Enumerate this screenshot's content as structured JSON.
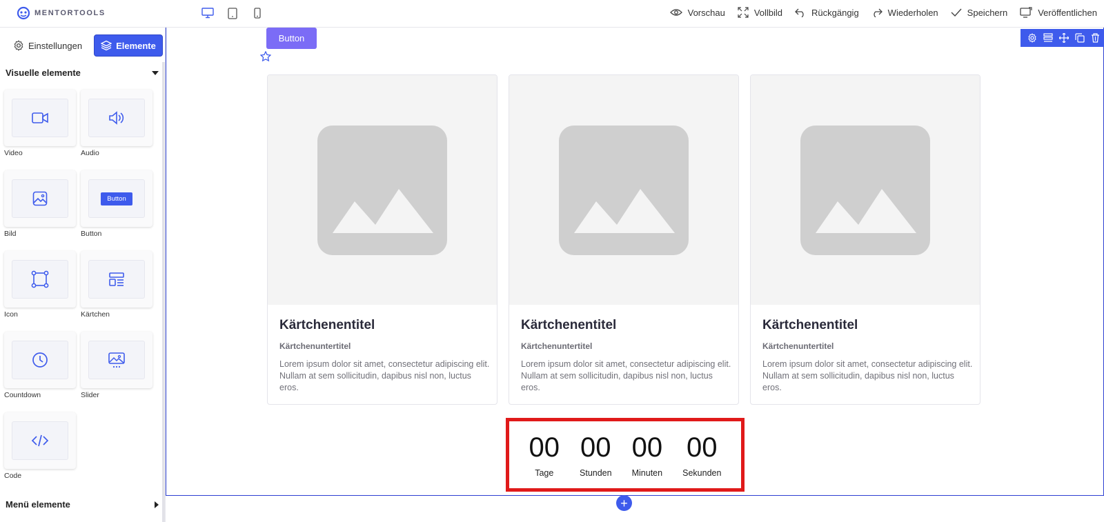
{
  "app": {
    "brand": "MENTORTOOLS"
  },
  "devices": [
    {
      "name": "desktop-icon"
    },
    {
      "name": "tablet-icon"
    },
    {
      "name": "mobile-icon"
    }
  ],
  "header": {
    "actions": [
      {
        "label": "Vorschau",
        "icon": "eye-icon"
      },
      {
        "label": "Vollbild",
        "icon": "fullscreen-icon"
      },
      {
        "label": "Rückgängig",
        "icon": "undo-icon"
      },
      {
        "label": "Wiederholen",
        "icon": "redo-icon"
      },
      {
        "label": "Speichern",
        "icon": "check-icon"
      },
      {
        "label": "Veröffentlichen",
        "icon": "monitor-publish-icon"
      }
    ]
  },
  "sidebar": {
    "tabs": [
      {
        "label": "Einstellungen",
        "icon": "gear-icon",
        "active": false
      },
      {
        "label": "Elemente",
        "icon": "layers-icon",
        "active": true
      }
    ],
    "visual_section_title": "Visuelle elemente",
    "elements": [
      {
        "label": "Video",
        "icon": "video-icon"
      },
      {
        "label": "Audio",
        "icon": "speaker-icon"
      },
      {
        "label": "Bild",
        "icon": "image-icon"
      },
      {
        "label": "Button",
        "icon": "button-preview",
        "preview_label": "Button"
      },
      {
        "label": "Icon",
        "icon": "bounding-box-icon"
      },
      {
        "label": "Kärtchen",
        "icon": "card-layout-icon"
      },
      {
        "label": "Countdown",
        "icon": "clock-icon"
      },
      {
        "label": "Slider",
        "icon": "slider-image-icon"
      },
      {
        "label": "Code",
        "icon": "code-icon"
      }
    ],
    "menu_section_title": "Menü elemente"
  },
  "canvas": {
    "button_label": "Button",
    "cards": [
      {
        "title": "Kärtchenentitel",
        "subtitle": "Kärtchenuntertitel",
        "text": "Lorem ipsum dolor sit amet, consectetur adipiscing elit. Nullam at sem sollicitudin, dapibus nisl non, luctus eros."
      },
      {
        "title": "Kärtchenentitel",
        "subtitle": "Kärtchenuntertitel",
        "text": "Lorem ipsum dolor sit amet, consectetur adipiscing elit. Nullam at sem sollicitudin, dapibus nisl non, luctus eros."
      },
      {
        "title": "Kärtchenentitel",
        "subtitle": "Kärtchenuntertitel",
        "text": "Lorem ipsum dolor sit amet, consectetur adipiscing elit. Nullam at sem sollicitudin, dapibus nisl non, luctus eros."
      }
    ],
    "countdown": [
      {
        "value": "00",
        "label": "Tage"
      },
      {
        "value": "00",
        "label": "Stunden"
      },
      {
        "value": "00",
        "label": "Minuten"
      },
      {
        "value": "00",
        "label": "Sekunden"
      }
    ],
    "toolbar_icons": [
      "gear-icon",
      "rows-icon",
      "move-icon",
      "duplicate-icon",
      "trash-icon"
    ],
    "add_label": "+"
  },
  "colors": {
    "accent": "#3e5bec",
    "button_purple": "#7b6cf6",
    "highlight_red": "#e01a1a"
  }
}
